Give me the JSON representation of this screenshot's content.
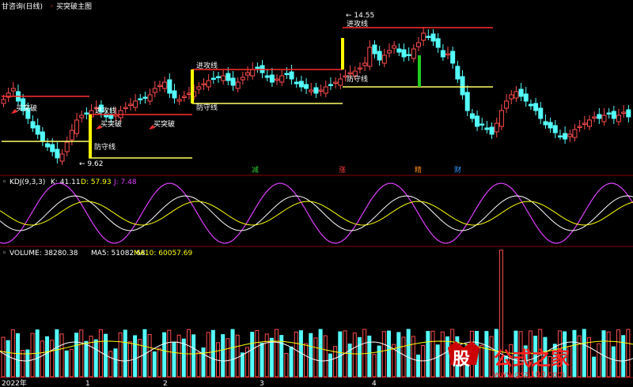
{
  "header": {
    "stock_name": "甘咨询(日线)",
    "indicator_name": "买突破主图"
  },
  "main_panel": {
    "high_marker": "14.55",
    "low_marker": "9.62",
    "labels": {
      "attack": "进攻线",
      "defense": "防守线",
      "buy_breakout": "买突破"
    },
    "tags": [
      "减",
      "涨",
      "精",
      "财"
    ]
  },
  "kdj": {
    "name": "KDJ(9,3,3)",
    "k_text": "K: 41.11",
    "d_text": "D: 57.93",
    "j_text": "J: 7.48",
    "colors": {
      "k": "#ffffff",
      "d": "#ffff00",
      "j": "#e040ff"
    }
  },
  "volume": {
    "name": "VOLUME: 38280.38",
    "ma5_text": "MA5: 51082.68",
    "ma10_text": "MA10: 60057.69"
  },
  "x_axis": {
    "labels": [
      "2022年",
      "1",
      "2",
      "3",
      "4"
    ]
  },
  "watermark": {
    "logo_char": "股",
    "title": "公式之家",
    "url": "www.gszj100.com"
  },
  "colors": {
    "up": "#ff4d4d",
    "down": "#54ffff",
    "attack_line": "#ff2d2d",
    "defense_line": "#ffff66",
    "background": "#000000"
  }
}
